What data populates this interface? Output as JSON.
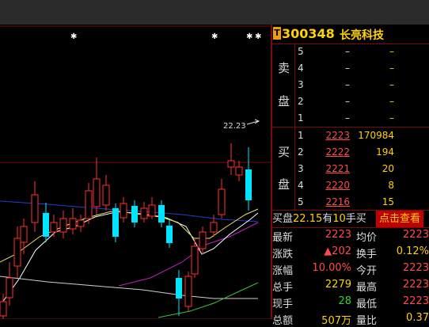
{
  "chart": {
    "price_label": "22.23",
    "markers": [
      "✱",
      "✱",
      "✱",
      "✱"
    ],
    "scroll_icon": "⇕"
  },
  "quote": {
    "badge": "T",
    "code": "300348",
    "name": "长亮科技",
    "sell_label_1": "卖",
    "sell_label_2": "盘",
    "buy_label_1": "买",
    "buy_label_2": "盘",
    "asks": [
      {
        "level": "5",
        "price": "–",
        "vol": "–"
      },
      {
        "level": "4",
        "price": "–",
        "vol": "–"
      },
      {
        "level": "3",
        "price": "–",
        "vol": "–"
      },
      {
        "level": "2",
        "price": "–",
        "vol": "–"
      },
      {
        "level": "1",
        "price": "–",
        "vol": "–"
      }
    ],
    "bids": [
      {
        "level": "1",
        "price": "2223",
        "vol": "170984"
      },
      {
        "level": "2",
        "price": "2222",
        "vol": "194"
      },
      {
        "level": "3",
        "price": "2221",
        "vol": "20"
      },
      {
        "level": "4",
        "price": "2220",
        "vol": "8"
      },
      {
        "level": "5",
        "price": "2216",
        "vol": "15"
      }
    ],
    "bar": {
      "prefix": "买盘",
      "price": "22.15",
      "mid": "有",
      "qty": "10",
      "suffix": "手买",
      "button": "点击查看"
    },
    "stats": [
      {
        "l1": "最新",
        "v1": "2223",
        "c1": "red",
        "l2": "均价",
        "v2": "2223",
        "c2": "red"
      },
      {
        "l1": "涨跌",
        "v1": "▲202",
        "c1": "red",
        "l2": "换手",
        "v2": "0.12%",
        "c2": "yellow"
      },
      {
        "l1": "涨幅",
        "v1": "10.00%",
        "c1": "red",
        "l2": "今开",
        "v2": "2223",
        "c2": "red"
      },
      {
        "l1": "总手",
        "v1": "2279",
        "c1": "yellow",
        "l2": "最高",
        "v2": "2223",
        "c2": "red"
      },
      {
        "l1": "现手",
        "v1": "28",
        "c1": "green",
        "l2": "最低",
        "v2": "2223",
        "c2": "red"
      },
      {
        "l1": "总额",
        "v1": "507万",
        "c1": "yellow",
        "l2": "量比",
        "v2": "0.37",
        "c2": "yellow"
      }
    ]
  }
}
